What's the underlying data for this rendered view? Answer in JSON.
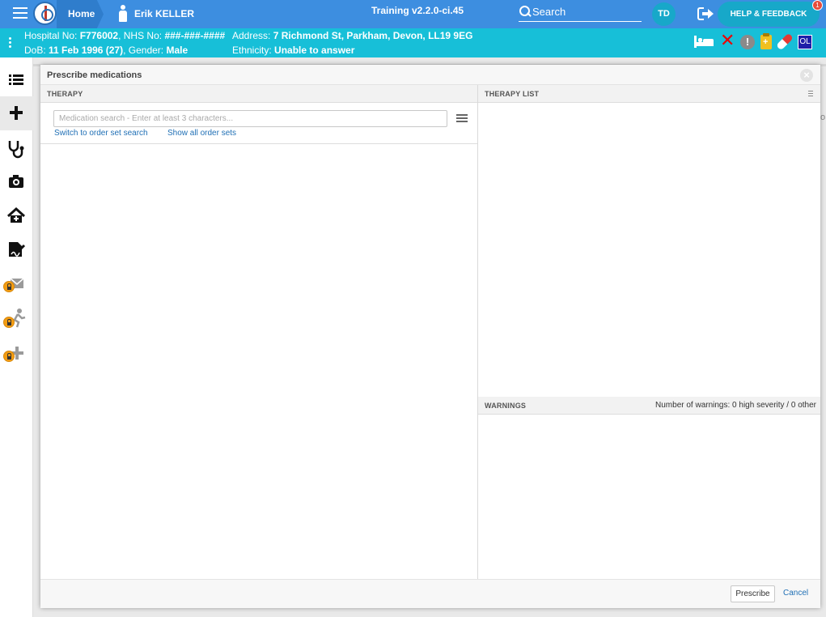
{
  "topbar": {
    "home_label": "Home",
    "patient_name": "Erik KELLER",
    "version": "Training v2.2.0-ci.45",
    "search_label": "Search",
    "user_initials": "TD",
    "help_label": "HELP & FEEDBACK",
    "help_badge": "1"
  },
  "banner": {
    "hospital_no_label": "Hospital No:",
    "hospital_no": "F776002",
    "nhs_no_label": "NHS No:",
    "nhs_no": "###-###-####",
    "address_label": "Address:",
    "address": "7 Richmond St, Parkham, Devon, LL19 9EG",
    "dob_label": "DoB:",
    "dob": "11 Feb 1996 (27)",
    "gender_label": "Gender:",
    "gender": "Male",
    "ethnicity_label": "Ethnicity:",
    "ethnicity": "Unable to answer",
    "badges": [
      "bed-icon",
      "red-x-icon",
      "alert-icon",
      "clipboard-icon",
      "pill-icon",
      "ol-badge"
    ],
    "ol_text": "OL"
  },
  "leftnav": {
    "items": [
      {
        "icon": "list-icon",
        "locked": false
      },
      {
        "icon": "plus-icon",
        "locked": false,
        "active": true
      },
      {
        "icon": "stethoscope-icon",
        "locked": false
      },
      {
        "icon": "camera-icon",
        "locked": false
      },
      {
        "icon": "home-plus-icon",
        "locked": false
      },
      {
        "icon": "signature-icon",
        "locked": false
      },
      {
        "icon": "envelope-icon",
        "locked": true
      },
      {
        "icon": "running-person-icon",
        "locked": true
      },
      {
        "icon": "add-icon",
        "locked": true
      }
    ]
  },
  "modal": {
    "title": "Prescribe medications",
    "therapy_header": "THERAPY",
    "therapy_list_header": "THERAPY LIST",
    "search_placeholder": "Medication search - Enter at least 3 characters...",
    "search_value": "",
    "switch_link": "Switch to order set search",
    "show_all_link": "Show all order sets",
    "warnings_header": "WARNINGS",
    "warnings_count": "Number of warnings: 0 high severity / 0 other",
    "prescribe_button": "Prescribe",
    "cancel_link": "Cancel"
  },
  "colors": {
    "topbar": "#3d8ee0",
    "banner": "#17bfd8",
    "link": "#1f6fb5",
    "lock": "#f39c12"
  }
}
